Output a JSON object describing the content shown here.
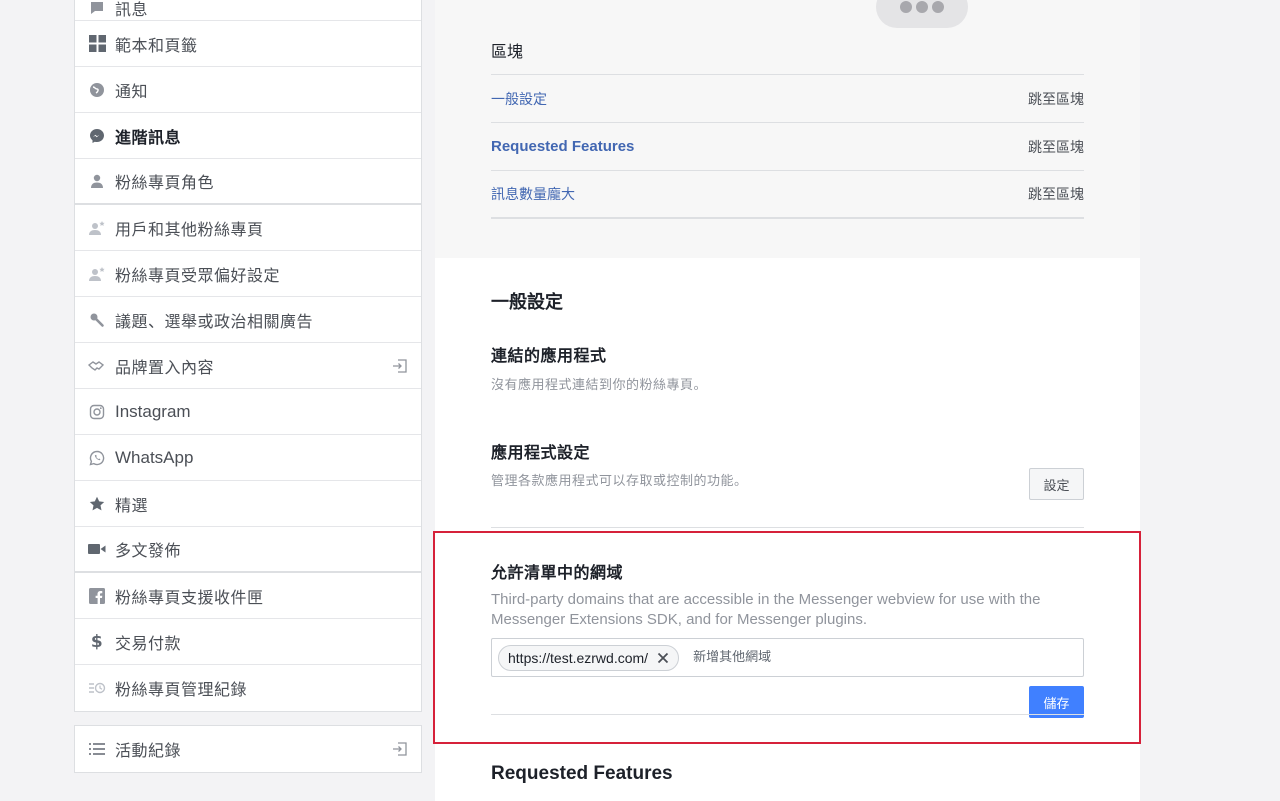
{
  "sidebar": {
    "items": [
      {
        "label": "訊息",
        "icon": "chat-icon"
      },
      {
        "label": "範本和頁籤",
        "icon": "grid-icon"
      },
      {
        "label": "通知",
        "icon": "globe-icon"
      },
      {
        "label": "進階訊息",
        "icon": "messenger-icon",
        "active": true
      },
      {
        "label": "粉絲專頁角色",
        "icon": "person-icon"
      },
      {
        "label": "用戶和其他粉絲專頁",
        "icon": "person-star-icon"
      },
      {
        "label": "粉絲專頁受眾偏好設定",
        "icon": "person-star-icon"
      },
      {
        "label": "議題、選舉或政治相關廣告",
        "icon": "wrench-icon"
      },
      {
        "label": "品牌置入內容",
        "icon": "handshake-icon"
      },
      {
        "label": "Instagram",
        "icon": "instagram-icon"
      },
      {
        "label": "WhatsApp",
        "icon": "whatsapp-icon"
      },
      {
        "label": "精選",
        "icon": "star-icon"
      },
      {
        "label": "多文發佈",
        "icon": "video-icon"
      },
      {
        "label": "粉絲專頁支援收件匣",
        "icon": "facebook-icon"
      },
      {
        "label": "交易付款",
        "icon": "dollar-icon"
      },
      {
        "label": "粉絲專頁管理紀錄",
        "icon": "log-icon"
      }
    ],
    "activity_log": {
      "label": "活動紀錄",
      "icon": "list-icon"
    }
  },
  "blocks": {
    "title": "區塊",
    "rows": [
      {
        "name": "一般設定",
        "jump": "跳至區塊"
      },
      {
        "name": "Requested Features",
        "jump": "跳至區塊"
      },
      {
        "name": "訊息數量龐大",
        "jump": "跳至區塊"
      }
    ]
  },
  "general": {
    "title": "一般設定",
    "linked_apps": {
      "title": "連結的應用程式",
      "desc": "沒有應用程式連結到你的粉絲專頁。"
    },
    "app_settings": {
      "title": "應用程式設定",
      "desc": "管理各款應用程式可以存取或控制的功能。",
      "button": "設定"
    }
  },
  "whitelist": {
    "title": "允許清單中的網域",
    "desc": "Third-party domains that are accessible in the Messenger webview for use with the Messenger Extensions SDK, and for Messenger plugins.",
    "domain_chip": "https://test.ezrwd.com/",
    "placeholder": "新增其他網域",
    "save": "儲存"
  },
  "requested_features": {
    "title": "Requested Features"
  },
  "colors": {
    "accent": "#4267b2",
    "primary_button": "#4080ff",
    "highlight": "#d6213a"
  }
}
